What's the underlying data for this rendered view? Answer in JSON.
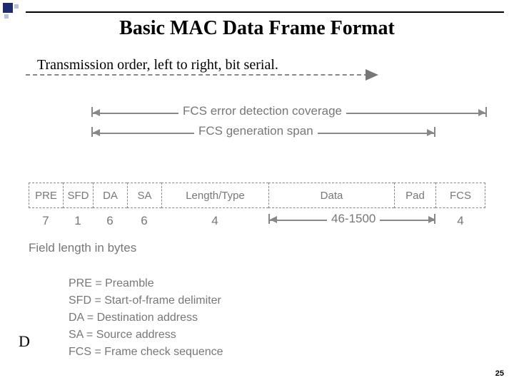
{
  "title": "Basic MAC Data Frame Format",
  "subtitle": "Transmission order, left to right, bit serial.",
  "coverage": {
    "line1": "FCS error detection coverage",
    "line2": "FCS generation span"
  },
  "fields": [
    {
      "name": "PRE",
      "bytes": "7"
    },
    {
      "name": "SFD",
      "bytes": "1"
    },
    {
      "name": "DA",
      "bytes": "6"
    },
    {
      "name": "SA",
      "bytes": "6"
    },
    {
      "name": "Length/Type",
      "bytes": "4"
    },
    {
      "name": "Data",
      "bytes": ""
    },
    {
      "name": "Pad",
      "bytes": ""
    },
    {
      "name": "FCS",
      "bytes": "4"
    }
  ],
  "dataRange": "46-1500",
  "fieldLenLabel": "Field length in bytes",
  "legend": {
    "PRE": "PRE = Preamble",
    "SFD": "SFD = Start-of-frame delimiter",
    "DA": "DA = Destination address",
    "SA": "SA = Source address",
    "FCS": "FCS = Frame check sequence"
  },
  "stray": "D",
  "page": "25"
}
